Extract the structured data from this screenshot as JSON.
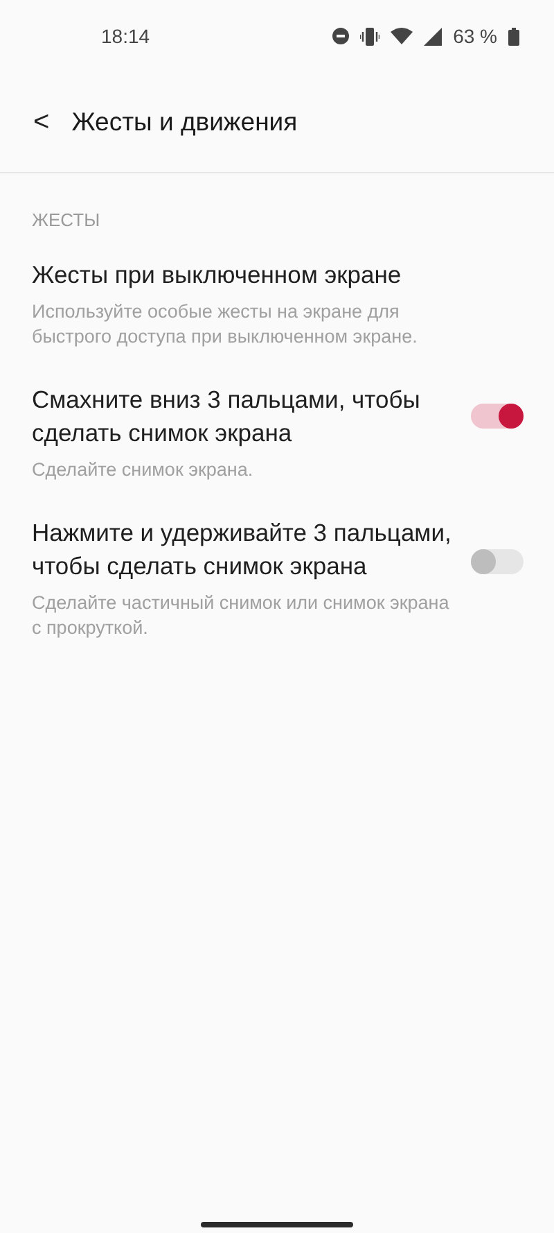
{
  "status_bar": {
    "time": "18:14",
    "battery": "63 %"
  },
  "header": {
    "back": "<",
    "title": "Жесты и движения"
  },
  "section": {
    "title": "ЖЕСТЫ"
  },
  "items": [
    {
      "kind": "link",
      "title": "Жесты при выключенном экране",
      "description": "Используйте особые жесты на экране для быстрого доступа при выключенном экране."
    },
    {
      "kind": "switch",
      "title": "Смахните вниз 3 пальцами, чтобы сделать снимок экрана",
      "description": "Сделайте снимок экрана.",
      "on": true
    },
    {
      "kind": "switch",
      "title": "Нажмите и удерживайте 3 пальцами, чтобы сделать снимок экрана",
      "description": "Сделайте частичный снимок или снимок экрана с прокруткой.",
      "on": false
    }
  ]
}
